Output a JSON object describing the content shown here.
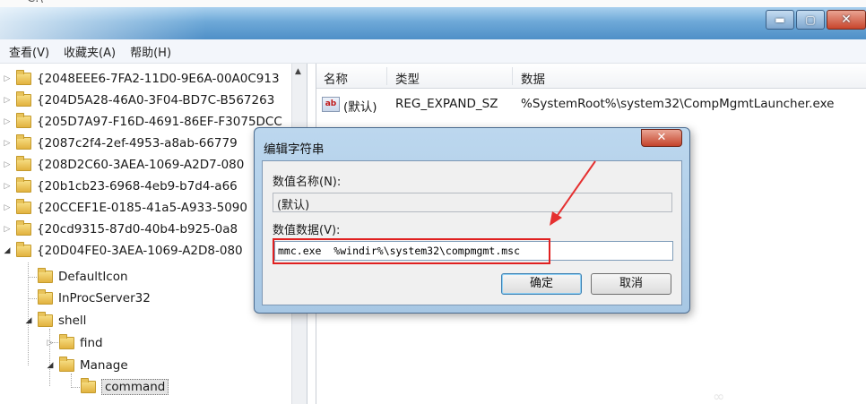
{
  "title_bar": {
    "min": "▬",
    "max": "▢",
    "close": "✕"
  },
  "menu": [
    "查看(V)",
    "收藏夹(A)",
    "帮助(H)"
  ],
  "tree": {
    "rows": [
      "{2048EEE6-7FA2-11D0-9E6A-00A0C913",
      "{204D5A28-46A0-3F04-BD7C-B567263",
      "{205D7A97-F16D-4691-86EF-F3075DCC",
      "{2087c2f4-2ef-4953-a8ab-66779",
      "{208D2C60-3AEA-1069-A2D7-080",
      "{20b1cb23-6968-4eb9-b7d4-a66",
      "{20CCEF1E-0185-41a5-A933-5090",
      "{20cd9315-87d0-40b4-b925-0a8",
      "{20D04FE0-3AEA-1069-A2D8-080"
    ],
    "children": [
      "DefaultIcon",
      "InProcServer32",
      "shell",
      "find",
      "Manage",
      "command"
    ]
  },
  "list": {
    "headers": {
      "name": "名称",
      "type": "类型",
      "data": "数据"
    },
    "row": {
      "name": "(默认)",
      "type": "REG_EXPAND_SZ",
      "data": "%SystemRoot%\\system32\\CompMgmtLauncher.exe"
    }
  },
  "dialog": {
    "title": "编辑字符串",
    "close": "✕",
    "name_label": "数值名称(N):",
    "name_value": "(默认)",
    "data_label": "数值数据(V):",
    "data_value": "mmc.exe  %windir%\\system32\\compmgmt.msc",
    "ok": "确定",
    "cancel": "取消"
  },
  "colors": {
    "highlight": "#e02020",
    "arrow": "#e53030"
  }
}
